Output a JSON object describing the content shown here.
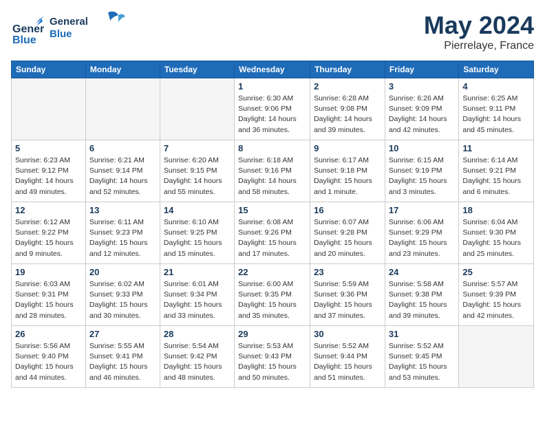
{
  "header": {
    "logo_general": "General",
    "logo_blue": "Blue",
    "month_year": "May 2024",
    "location": "Pierrelaye, France"
  },
  "weekdays": [
    "Sunday",
    "Monday",
    "Tuesday",
    "Wednesday",
    "Thursday",
    "Friday",
    "Saturday"
  ],
  "weeks": [
    [
      {
        "day": "",
        "info": "",
        "empty": true
      },
      {
        "day": "",
        "info": "",
        "empty": true
      },
      {
        "day": "",
        "info": "",
        "empty": true
      },
      {
        "day": "1",
        "info": "Sunrise: 6:30 AM\nSunset: 9:06 PM\nDaylight: 14 hours\nand 36 minutes."
      },
      {
        "day": "2",
        "info": "Sunrise: 6:28 AM\nSunset: 9:08 PM\nDaylight: 14 hours\nand 39 minutes."
      },
      {
        "day": "3",
        "info": "Sunrise: 6:26 AM\nSunset: 9:09 PM\nDaylight: 14 hours\nand 42 minutes."
      },
      {
        "day": "4",
        "info": "Sunrise: 6:25 AM\nSunset: 9:11 PM\nDaylight: 14 hours\nand 45 minutes."
      }
    ],
    [
      {
        "day": "5",
        "info": "Sunrise: 6:23 AM\nSunset: 9:12 PM\nDaylight: 14 hours\nand 49 minutes."
      },
      {
        "day": "6",
        "info": "Sunrise: 6:21 AM\nSunset: 9:14 PM\nDaylight: 14 hours\nand 52 minutes."
      },
      {
        "day": "7",
        "info": "Sunrise: 6:20 AM\nSunset: 9:15 PM\nDaylight: 14 hours\nand 55 minutes."
      },
      {
        "day": "8",
        "info": "Sunrise: 6:18 AM\nSunset: 9:16 PM\nDaylight: 14 hours\nand 58 minutes."
      },
      {
        "day": "9",
        "info": "Sunrise: 6:17 AM\nSunset: 9:18 PM\nDaylight: 15 hours\nand 1 minute."
      },
      {
        "day": "10",
        "info": "Sunrise: 6:15 AM\nSunset: 9:19 PM\nDaylight: 15 hours\nand 3 minutes."
      },
      {
        "day": "11",
        "info": "Sunrise: 6:14 AM\nSunset: 9:21 PM\nDaylight: 15 hours\nand 6 minutes."
      }
    ],
    [
      {
        "day": "12",
        "info": "Sunrise: 6:12 AM\nSunset: 9:22 PM\nDaylight: 15 hours\nand 9 minutes."
      },
      {
        "day": "13",
        "info": "Sunrise: 6:11 AM\nSunset: 9:23 PM\nDaylight: 15 hours\nand 12 minutes."
      },
      {
        "day": "14",
        "info": "Sunrise: 6:10 AM\nSunset: 9:25 PM\nDaylight: 15 hours\nand 15 minutes."
      },
      {
        "day": "15",
        "info": "Sunrise: 6:08 AM\nSunset: 9:26 PM\nDaylight: 15 hours\nand 17 minutes."
      },
      {
        "day": "16",
        "info": "Sunrise: 6:07 AM\nSunset: 9:28 PM\nDaylight: 15 hours\nand 20 minutes."
      },
      {
        "day": "17",
        "info": "Sunrise: 6:06 AM\nSunset: 9:29 PM\nDaylight: 15 hours\nand 23 minutes."
      },
      {
        "day": "18",
        "info": "Sunrise: 6:04 AM\nSunset: 9:30 PM\nDaylight: 15 hours\nand 25 minutes."
      }
    ],
    [
      {
        "day": "19",
        "info": "Sunrise: 6:03 AM\nSunset: 9:31 PM\nDaylight: 15 hours\nand 28 minutes."
      },
      {
        "day": "20",
        "info": "Sunrise: 6:02 AM\nSunset: 9:33 PM\nDaylight: 15 hours\nand 30 minutes."
      },
      {
        "day": "21",
        "info": "Sunrise: 6:01 AM\nSunset: 9:34 PM\nDaylight: 15 hours\nand 33 minutes."
      },
      {
        "day": "22",
        "info": "Sunrise: 6:00 AM\nSunset: 9:35 PM\nDaylight: 15 hours\nand 35 minutes."
      },
      {
        "day": "23",
        "info": "Sunrise: 5:59 AM\nSunset: 9:36 PM\nDaylight: 15 hours\nand 37 minutes."
      },
      {
        "day": "24",
        "info": "Sunrise: 5:58 AM\nSunset: 9:38 PM\nDaylight: 15 hours\nand 39 minutes."
      },
      {
        "day": "25",
        "info": "Sunrise: 5:57 AM\nSunset: 9:39 PM\nDaylight: 15 hours\nand 42 minutes."
      }
    ],
    [
      {
        "day": "26",
        "info": "Sunrise: 5:56 AM\nSunset: 9:40 PM\nDaylight: 15 hours\nand 44 minutes."
      },
      {
        "day": "27",
        "info": "Sunrise: 5:55 AM\nSunset: 9:41 PM\nDaylight: 15 hours\nand 46 minutes."
      },
      {
        "day": "28",
        "info": "Sunrise: 5:54 AM\nSunset: 9:42 PM\nDaylight: 15 hours\nand 48 minutes."
      },
      {
        "day": "29",
        "info": "Sunrise: 5:53 AM\nSunset: 9:43 PM\nDaylight: 15 hours\nand 50 minutes."
      },
      {
        "day": "30",
        "info": "Sunrise: 5:52 AM\nSunset: 9:44 PM\nDaylight: 15 hours\nand 51 minutes."
      },
      {
        "day": "31",
        "info": "Sunrise: 5:52 AM\nSunset: 9:45 PM\nDaylight: 15 hours\nand 53 minutes."
      },
      {
        "day": "",
        "info": "",
        "empty": true
      }
    ]
  ]
}
